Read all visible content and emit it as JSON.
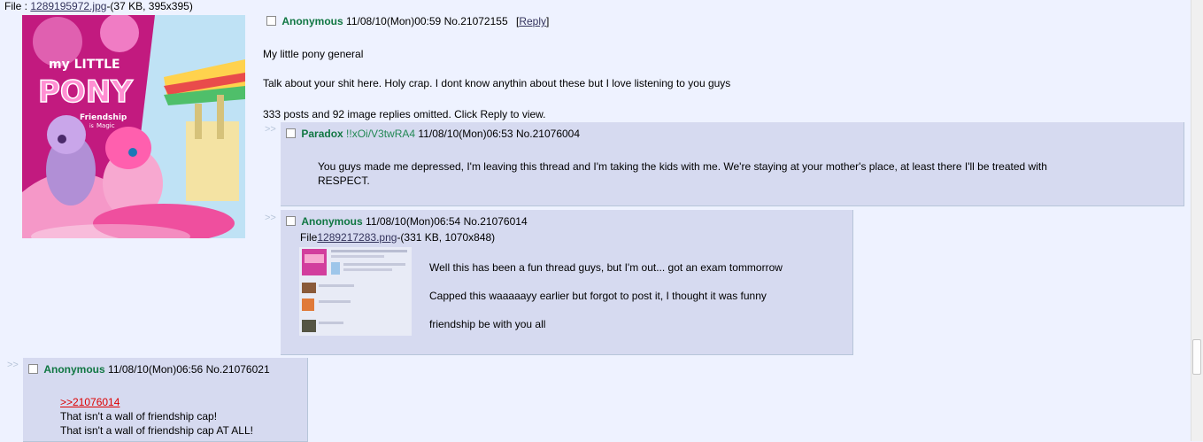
{
  "op": {
    "file_prefix": "File : ",
    "file_name": "1289195972.jpg",
    "file_meta": "-(37 KB, 395x395)",
    "name": "Anonymous",
    "datetime": "11/08/10(Mon)00:59",
    "post_no": "No.21072155",
    "reply_open": "[",
    "reply_label": "Reply",
    "reply_close": "]",
    "subject_line": "My little pony general",
    "body": "Talk about your shit here. Holy crap. I dont know anythin about these but I love listening to you guys",
    "omitted": "333 posts and 92 image replies omitted. Click Reply to view.",
    "thumb_logo_lines": [
      "my LITTLE",
      "PONY"
    ],
    "thumb_sub_lines": [
      "Friendship",
      "is",
      "Magic"
    ]
  },
  "replies": [
    {
      "arrows": ">>",
      "name": "Paradox",
      "tripcode": "!!xOi/V3twRA4",
      "datetime": "11/08/10(Mon)06:53",
      "post_no": "No.21076004",
      "body_lines": [
        "You guys made me depressed, I'm leaving this thread and I'm taking the kids with me. We're staying at your mother's place, at least there I'll be treated with",
        "RESPECT."
      ]
    },
    {
      "arrows": ">>",
      "name": "Anonymous",
      "datetime": "11/08/10(Mon)06:54",
      "post_no": "No.21076014",
      "file_prefix": "File",
      "file_name": "1289217283.png",
      "file_meta": "-(331 KB, 1070x848)",
      "body_lines": [
        "Well this has been a fun thread guys, but I'm out... got an exam tommorrow",
        "Capped this waaaaayy earlier but forgot to post it, I thought it was funny",
        "friendship be with you all"
      ]
    },
    {
      "arrows": ">>",
      "name": "Anonymous",
      "datetime": "11/08/10(Mon)06:56",
      "post_no": "No.21076021",
      "quote": ">>21076014",
      "body_lines": [
        "That isn't a wall of friendship cap!",
        "That isn't a wall of friendship cap AT ALL!"
      ]
    }
  ],
  "colors": {
    "background": "#eef2ff",
    "reply_bg": "#d6daf0",
    "name": "#117743",
    "link": "#34345c",
    "quote": "#dd0000"
  }
}
